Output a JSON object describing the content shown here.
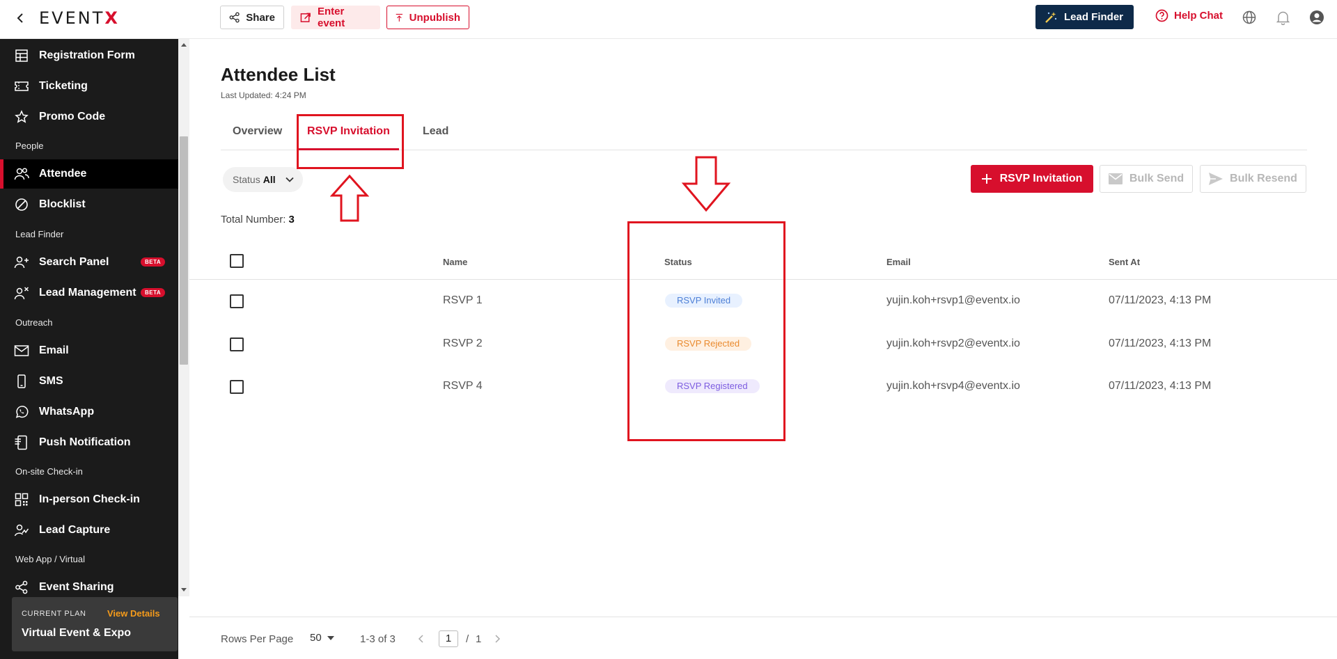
{
  "topbar": {
    "logo": "EVENTX",
    "share_label": "Share",
    "enter_event_label": "Enter event",
    "unpublish_label": "Unpublish",
    "lead_finder_label": "Lead Finder",
    "help_chat_label": "Help Chat"
  },
  "sidebar": {
    "items": [
      {
        "label": "Registration Form",
        "icon": "table-icon"
      },
      {
        "label": "Ticketing",
        "icon": "ticket-icon"
      },
      {
        "label": "Promo Code",
        "icon": "star-icon"
      },
      {
        "label": "Attendee",
        "icon": "people-icon",
        "active": true
      },
      {
        "label": "Blocklist",
        "icon": "block-icon"
      },
      {
        "label": "Search Panel",
        "icon": "person-add-icon",
        "badge": "BETA"
      },
      {
        "label": "Lead Management",
        "icon": "person-x-icon",
        "badge": "BETA"
      },
      {
        "label": "Email",
        "icon": "mail-icon"
      },
      {
        "label": "SMS",
        "icon": "phone-icon"
      },
      {
        "label": "WhatsApp",
        "icon": "whatsapp-icon"
      },
      {
        "label": "Push Notification",
        "icon": "push-icon"
      },
      {
        "label": "In-person Check-in",
        "icon": "qr-icon"
      },
      {
        "label": "Lead Capture",
        "icon": "lead-capture-icon"
      },
      {
        "label": "Event Sharing",
        "icon": "share-icon"
      }
    ],
    "sections": [
      "People",
      "Lead Finder",
      "Outreach",
      "On-site Check-in",
      "Web App / Virtual"
    ],
    "plan": {
      "label": "CURRENT PLAN",
      "link": "View Details",
      "name": "Virtual Event & Expo"
    }
  },
  "main": {
    "title": "Attendee List",
    "last_updated": "Last Updated: 4:24 PM",
    "tabs": [
      "Overview",
      "RSVP Invitation",
      "Lead"
    ],
    "active_tab": "RSVP Invitation",
    "filter": {
      "label": "Status",
      "value": "All"
    },
    "actions": {
      "rsvp_invitation": "RSVP Invitation",
      "bulk_send": "Bulk Send",
      "bulk_resend": "Bulk Resend"
    },
    "total_label": "Total Number:",
    "total_value": "3",
    "columns": [
      "Name",
      "Status",
      "Email",
      "Sent At"
    ],
    "rows": [
      {
        "name": "RSVP 1",
        "status": "RSVP Invited",
        "email": "yujin.koh+rsvp1@eventx.io",
        "sent_at": "07/11/2023, 4:13 PM"
      },
      {
        "name": "RSVP 2",
        "status": "RSVP Rejected",
        "email": "yujin.koh+rsvp2@eventx.io",
        "sent_at": "07/11/2023, 4:13 PM"
      },
      {
        "name": "RSVP 4",
        "status": "RSVP Registered",
        "email": "yujin.koh+rsvp4@eventx.io",
        "sent_at": "07/11/2023, 4:13 PM"
      }
    ],
    "footer": {
      "rows_per_page_label": "Rows Per Page",
      "rows_per_page": "50",
      "range": "1-3 of 3",
      "page": "1",
      "page_sep": "/",
      "page_total": "1"
    }
  },
  "colors": {
    "brand_red": "#d70f2d",
    "sidebar_bg": "#1b1b1b",
    "lead_finder_bg": "#0e2a49",
    "plan_link": "#f59b1b",
    "annotation_red": "#e0141f"
  }
}
